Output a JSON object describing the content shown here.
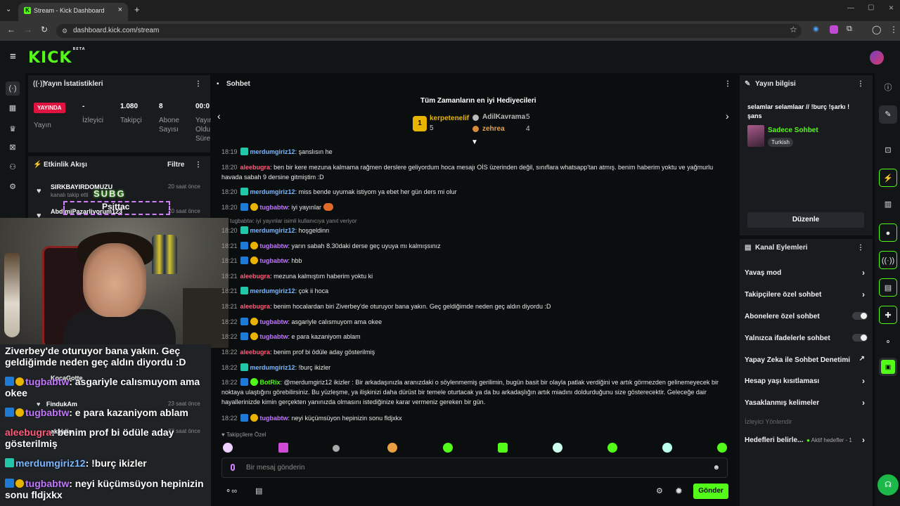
{
  "browser": {
    "tab_title": "Stream - Kick Dashboard",
    "url": "dashboard.kick.com/stream"
  },
  "header": {
    "logo": "KICK",
    "logo_tag": "BETA"
  },
  "stats_panel": {
    "title": "Yayın İstatistikleri",
    "live_badge": "YAYINDA",
    "live_label": "Yayın",
    "viewers_value": "-",
    "viewers_label": "İzleyici",
    "followers_value": "1.080",
    "followers_label": "Takipçi",
    "subs_value": "8",
    "subs_label": "Abone Sayısı",
    "duration_value": "00:0",
    "duration_label": "Yayın Oldu Süre"
  },
  "activity_panel": {
    "title": "Etkinlik Akışı",
    "filter_label": "Filtre",
    "items": [
      {
        "name": "SIRKBAYIRDOMUZU",
        "sub": "kanalı takip etti",
        "time": "20 saat önce"
      },
      {
        "name": "AbdimiPazarliyorum123",
        "sub": "kanalı takip etti",
        "time": "20 saat önce"
      },
      {
        "name": "KocaGotte",
        "sub": "kanalı takip etti",
        "time": ""
      },
      {
        "name": "FindukAm",
        "sub": "kanalı takip etti",
        "time": "23 saat önce"
      },
      {
        "name": "akaldim",
        "sub": "kanalı takip etti",
        "time": "23 saat önce"
      }
    ]
  },
  "webcam_overlay": {
    "sub_alert_line1": "SUBG",
    "sub_alert_line2": "Psittac"
  },
  "overlay_chat": [
    {
      "user": "",
      "text": "Ziverbey'de oturuyor bana yakın. Geç"
    },
    {
      "user": "",
      "text": "geldiğimde neden geç aldın diyordu :D"
    },
    {
      "user": "tugbabtw",
      "text": ": asgariyle calısmuyom ama"
    },
    {
      "user": "",
      "text": "okee"
    },
    {
      "user": "tugbabtw",
      "text": ": e para kazaniyom ablam"
    },
    {
      "user": "aleebugra",
      "text": ": benim prof bi ödüle aday"
    },
    {
      "user": "",
      "text": "gösterilmiş"
    },
    {
      "user": "merdumgiriz12",
      "text": ": !burç ikizler"
    },
    {
      "user": "tugbabtw",
      "text": ": neyi küçümsüyon hepinizin"
    },
    {
      "user": "",
      "text": "sonu fldjxkx"
    }
  ],
  "chat_panel": {
    "title": "Sohbet",
    "gifters_title": "Tüm Zamanların en iyi Hediyecileri",
    "gifters": [
      {
        "name": "kerpetenelif",
        "count": "5"
      },
      {
        "name": "AdilKavrama",
        "count": "5"
      },
      {
        "name": "zehrea",
        "count": "4"
      }
    ],
    "messages": [
      {
        "time": "18:19",
        "user": "merdumgiriz12",
        "color": "blue",
        "text": ": şanslısın he"
      },
      {
        "time": "18:20",
        "user": "aleebugra",
        "color": "red",
        "text": ": ben bir kere mezuna kalmama rağmen derslere geliyordum hoca mesajı OİS üzerinden değil, sınıflara whatsapp'tan atmış. benim haberim yoktu ve yağmurlu havada sabah 9 dersine gitmiştim :D"
      },
      {
        "time": "18:20",
        "user": "merdumgiriz12",
        "color": "blue",
        "text": ": miss bende uyumak istiyom ya ebet her gün ders mi olur"
      },
      {
        "time": "18:20",
        "user": "tugbabtw",
        "color": "purple",
        "text": ": iyi yayınlar"
      },
      {
        "time": "",
        "user": "",
        "color": "",
        "text": "tugbabtw: iyi yayınlar   isimli kullanıcıya yanıt veriyor"
      },
      {
        "time": "18:20",
        "user": "merdumgiriz12",
        "color": "blue",
        "text": ": hoşgeldinn"
      },
      {
        "time": "18:21",
        "user": "tugbabtw",
        "color": "purple",
        "text": ": yarın sabah 8.30daki derse geç uyuya mı kalmışsınız"
      },
      {
        "time": "18:21",
        "user": "tugbabtw",
        "color": "purple",
        "text": ": hbb"
      },
      {
        "time": "18:21",
        "user": "aleebugra",
        "color": "red",
        "text": ": mezuna kalmıştım haberim yoktu ki"
      },
      {
        "time": "18:21",
        "user": "merdumgiriz12",
        "color": "blue",
        "text": ": çok ii hoca"
      },
      {
        "time": "18:21",
        "user": "aleebugra",
        "color": "red",
        "text": ": benim hocalardan biri Ziverbey'de oturuyor bana yakın. Geç geldiğimde neden geç aldın diyordu :D"
      },
      {
        "time": "18:22",
        "user": "tugbabtw",
        "color": "purple",
        "text": ": asgariyle calısmuyom ama okee"
      },
      {
        "time": "18:22",
        "user": "tugbabtw",
        "color": "purple",
        "text": ": e para kazaniyom ablam"
      },
      {
        "time": "18:22",
        "user": "aleebugra",
        "color": "red",
        "text": ": benim prof bi ödüle aday gösterilmiş"
      },
      {
        "time": "18:22",
        "user": "merdumgiriz12",
        "color": "blue",
        "text": ": !burç ikizler"
      },
      {
        "time": "18:22",
        "user": "BotRix",
        "color": "green",
        "text": ": @merdumgiriz12 ikizler : Bir arkadaşınızla aranızdaki o söylenmemiş gerilimin, bugün basit bir olayla patlak verdiğini ve artık görmezden gelinemeyecek bir noktaya ulaştığını görebilirsiniz. Bu yüzleşme, ya ilişkinizi daha dürüst bir temele oturtacak ya da bu arkadaşlığın artık miadını doldurduğunu size gösterecektir. Geleceğe dair hayallerinizde kimin gerçekten yanınızda olmasını istediğinize karar vermeniz gereken bir gün."
      },
      {
        "time": "18:22",
        "user": "tugbabtw",
        "color": "purple",
        "text": ": neyi küçümsüyon hepinizin sonu fldjxkx"
      }
    ],
    "followers_only_label": "Takipçilere Özel",
    "input_placeholder": "Bir mesaj gönderin",
    "send_label": "Gönder"
  },
  "stream_info": {
    "title": "Yayın bilgisi",
    "stream_title": "selamlar selamlaar // !burç !şarkı ! şans",
    "category": "Sadece Sohbet",
    "tag": "Turkish",
    "edit_label": "Düzenle"
  },
  "channel_actions": {
    "title": "Kanal Eylemleri",
    "rows": [
      {
        "label": "Yavaş mod",
        "control": "arrow"
      },
      {
        "label": "Takipçilere özel sohbet",
        "control": "arrow"
      },
      {
        "label": "Abonelere özel sohbet",
        "control": "toggle"
      },
      {
        "label": "Yalnızca ifadelerle sohbet",
        "control": "toggle"
      },
      {
        "label": "Yapay Zeka ile Sohbet Denetimi",
        "control": "external"
      },
      {
        "label": "Hesap yaşı kısıtlaması",
        "control": "arrow"
      },
      {
        "label": "Yasaklanmış kelimeler",
        "control": "arrow"
      }
    ],
    "section_label": "İzleyici Yönlendir",
    "goals_label": "Hedefleri belirle...",
    "goals_status": "Aktif hedefler - 1"
  },
  "colors": {
    "accent": "#53fc18",
    "live": "#e0123f",
    "panel": "#191b1f",
    "background": "#0b0e0f"
  }
}
